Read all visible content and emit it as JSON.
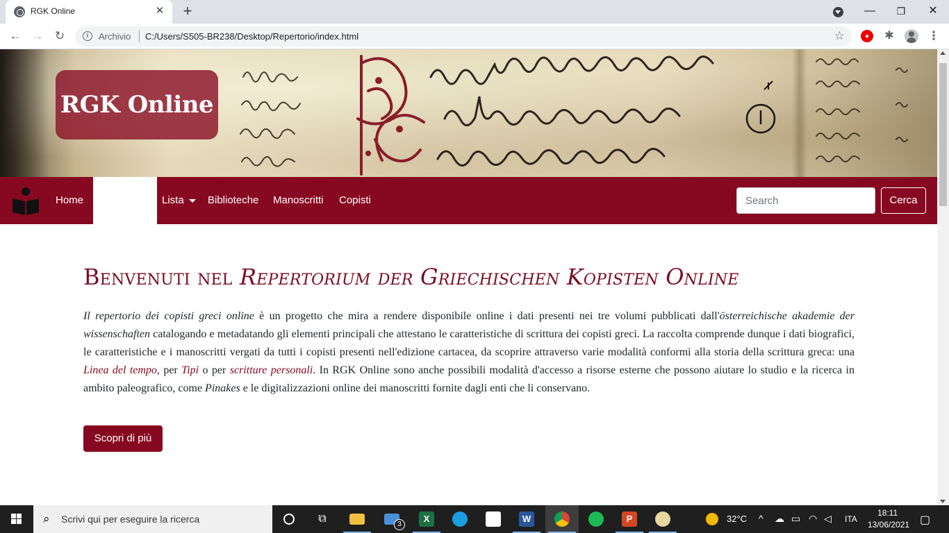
{
  "browser": {
    "tab_title": "RGK Online",
    "close_glyph": "✕",
    "newtab_glyph": "+",
    "omnibox_prefix": "Archivio",
    "url": "C:/Users/S505-BR238/Desktop/Repertorio/index.html",
    "minimize_glyph": "—",
    "maximize_glyph": "❐",
    "close_window_glyph": "✕"
  },
  "banner": {
    "logo": "RGK Online"
  },
  "navbar": {
    "home": "Home",
    "lista": "Lista",
    "biblioteche": "Biblioteche",
    "manoscritti": "Manoscritti",
    "copisti": "Copisti",
    "search_placeholder": "Search",
    "search_button": "Cerca"
  },
  "main": {
    "title_plain": "Benvenuti nel ",
    "title_italic": "Repertorium der Griechischen Kopisten Online",
    "intro": {
      "p1_italic": "Il repertorio dei copisti greci online",
      "p2": " è un progetto che mira a rendere disponibile online i dati presenti nei tre volumi pubblicati dall'",
      "p3_italic": "österreichische akademie der wissenschaften",
      "p4": " catalogando e metadatando gli elementi principali che attestano le caratteristiche di scrittura dei copisti greci. La raccolta comprende dunque i dati biografici, le caratteristiche e i manoscritti vergati da tutti i copisti presenti nell'edizione cartacea, da scoprire attraverso varie modalità conformi alla storia della scrittura greca: una ",
      "link_linea": "Linea del tempo",
      "p5": ", per ",
      "link_tipi": "Tipi",
      "p6": " o per ",
      "link_scritture": "scritture personali",
      "p7": ". In RGK Online sono anche possibili modalità d'accesso a risorse esterne che possono aiutare lo studio e la ricerca in ambito paleografico, come ",
      "p8_italic": "Pinakes",
      "p9": " e le digitalizzazioni online dei manoscritti fornite dagli enti che li conservano."
    },
    "more_button": "Scopri di più"
  },
  "taskbar": {
    "search_text": "Scrivi qui per eseguire la ricerca",
    "mail_badge": "3",
    "temperature": "32°C",
    "language": "ITA",
    "time": "18:11",
    "date": "13/06/2021"
  },
  "colors": {
    "brand": "#870921",
    "title": "#7a0c24"
  }
}
